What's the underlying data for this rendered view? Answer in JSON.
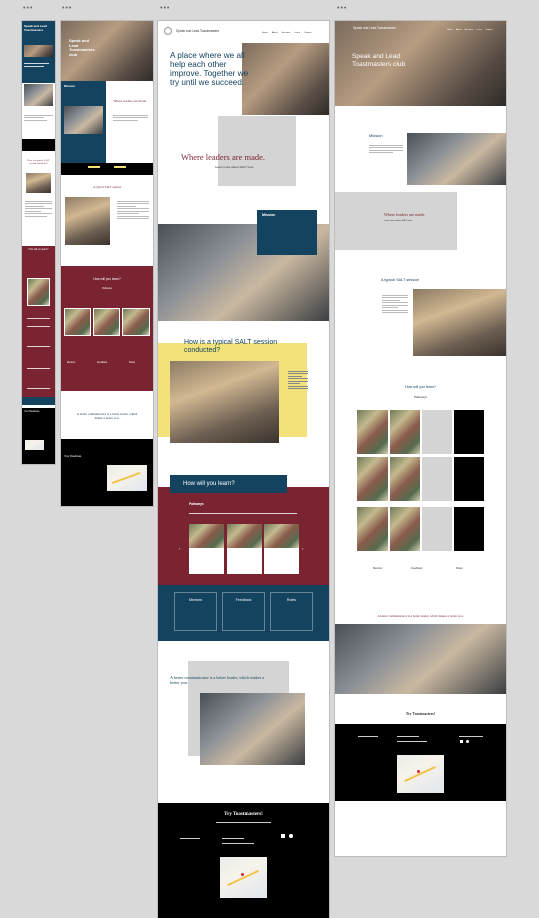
{
  "canvas": {
    "menu_glyph": "•••"
  },
  "site": {
    "name": "Speak and Lead Toastmasters",
    "club_name": "Speak and Lead Toastmasters club",
    "nav_items": [
      "Home",
      "About",
      "Sessions",
      "Learn",
      "Contact"
    ]
  },
  "hero": {
    "tagline": "A place where we all help each other improve. Together we try until we succeed.",
    "motto": "Where leaders are made.",
    "learn_more": "Learn more about SALT here"
  },
  "mission": {
    "title": "Mission"
  },
  "session": {
    "title": "How is a typical SALT session conducted?",
    "title_short": "A typical SALT session"
  },
  "learn": {
    "title": "How will you learn?",
    "pathways": "Pathways",
    "pillars": [
      "Mentors",
      "Feedback",
      "Roles"
    ]
  },
  "quote": {
    "text": "A better communicator is a better leader, which makes a better you."
  },
  "footer": {
    "cta": "Try Toastmasters!",
    "your_roadmap": "Your Roadmap"
  },
  "colors": {
    "maroon": "#7a2431",
    "navy": "#14435f",
    "yellow": "#f3e27a",
    "grey": "#d4d4d4"
  }
}
